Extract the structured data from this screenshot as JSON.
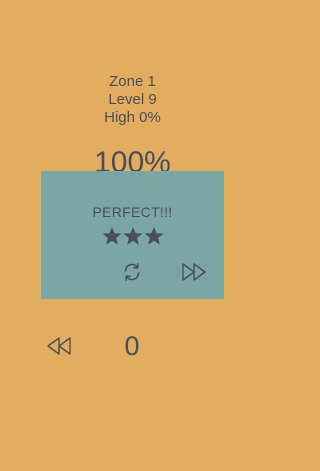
{
  "header": {
    "zone": "Zone 1",
    "level": "Level 9",
    "high": "High 0%"
  },
  "progress": {
    "percent_label": "100%",
    "value": 1.0
  },
  "modal": {
    "result_label": "PERFECT!!!",
    "stars_earned": 3,
    "stars_total": 3,
    "star_icon": "star-icon",
    "replay_icon": "replay-icon",
    "next_icon": "fast-forward-icon"
  },
  "footer": {
    "rewind_icon": "rewind-icon",
    "count": "0"
  },
  "colors": {
    "background": "#e3ad5f",
    "modal": "#7aa7a3",
    "text": "#4a4f5b"
  }
}
